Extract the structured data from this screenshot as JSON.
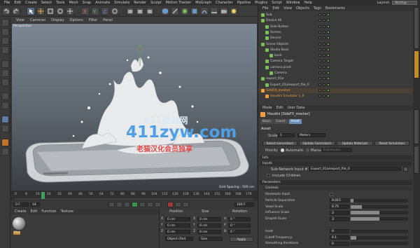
{
  "menubar": {
    "items": [
      "File",
      "Edit",
      "Create",
      "Select",
      "Tools",
      "Mesh",
      "Snap",
      "Animate",
      "Simulate",
      "Render",
      "Sculpt",
      "Motion Tracker",
      "MoGraph",
      "Character",
      "Pipeline",
      "Plugins",
      "Script",
      "Window",
      "Help"
    ],
    "layout_label": "Layout:",
    "layout_value": "Startup"
  },
  "viewport": {
    "menu": [
      "View",
      "Cameras",
      "Display",
      "Options",
      "Filter",
      "Panel"
    ],
    "label": "Perspective",
    "grid_spacing": "Grid Spacing : 500 cm"
  },
  "timeline": {
    "ticks": [
      "0",
      "8",
      "16",
      "24",
      "32",
      "40",
      "48",
      "56",
      "64",
      "72",
      "80",
      "88",
      "96",
      "104",
      "112",
      "120",
      "128",
      "136",
      "144",
      "152",
      "160",
      "168",
      "176"
    ],
    "current": "18 F"
  },
  "transport": {
    "start": "0 F",
    "end": "180 F",
    "frame": "18"
  },
  "material": {
    "menu": [
      "Create",
      "Edit",
      "Function",
      "Texture"
    ],
    "swatch_label": "Mat"
  },
  "coordinates": {
    "headers": [
      "Position",
      "Size",
      "Rotation"
    ],
    "rows": [
      {
        "axis": "X",
        "pos": "0 cm",
        "size_axis": "X",
        "size": "0 cm",
        "rot_axis": "H",
        "rot": "0 °"
      },
      {
        "axis": "Y",
        "pos": "0 cm",
        "size_axis": "Y",
        "size": "0 cm",
        "rot_axis": "P",
        "rot": "0 °"
      },
      {
        "axis": "Z",
        "pos": "0 cm",
        "size_axis": "Z",
        "size": "0 cm",
        "rot_axis": "B",
        "rot": "0 °"
      }
    ],
    "mode": "Object (Rel)",
    "size_mode": "Size",
    "apply": "Apply"
  },
  "objects": {
    "menu": [
      "File",
      "Edit",
      "View",
      "Objects",
      "Tags",
      "Bookmarks"
    ],
    "rows": [
      {
        "name": "Sub",
        "indent": 0,
        "color": "#c8c8c8"
      },
      {
        "name": "Device All",
        "indent": 0,
        "color": "#c8c8c8"
      },
      {
        "name": "Side Button",
        "indent": 1,
        "color": "#c8c8c8"
      },
      {
        "name": "Screen",
        "indent": 1,
        "color": "#c8c8c8"
      },
      {
        "name": "Device",
        "indent": 1,
        "color": "#c8c8c8"
      },
      {
        "name": "Scene Objects",
        "indent": 0,
        "color": "#c8c8c8"
      },
      {
        "name": "Studio Back",
        "indent": 1,
        "color": "#c8c8c8"
      },
      {
        "name": "back",
        "indent": 2,
        "color": "#c8c8c8"
      },
      {
        "name": "Camera Target",
        "indent": 1,
        "color": "#c8c8c8"
      },
      {
        "name": "camera pivot",
        "indent": 1,
        "color": "#c8c8c8"
      },
      {
        "name": "Camera",
        "indent": 2,
        "color": "#c8c8c8"
      },
      {
        "name": "export_01a",
        "indent": 0,
        "color": "#c8c8c8"
      },
      {
        "name": "Export_01a/export_file_0",
        "indent": 1,
        "color": "#c8c8c8"
      },
      {
        "name": "SideFX_mesher",
        "indent": 0,
        "color": "#f0a040"
      },
      {
        "name": "Houdini Emulator 1_0",
        "indent": 1,
        "color": "#f0a040"
      }
    ]
  },
  "attributes": {
    "menu": [
      "Mode",
      "Edit",
      "User Data"
    ],
    "title": "Houdini [SideFX_mesher]",
    "tabs": [
      "Basic",
      "Coord.",
      "Asset"
    ],
    "active_tab": "Asset",
    "asset_section": "Asset",
    "scale_label": "Scale",
    "scale_value": "1",
    "scale_unit": "Meters",
    "buttons": [
      "Select Generators",
      "Update Generators",
      "Update Materials",
      "Reset Simulation"
    ],
    "priority_label": "Priority",
    "priority_value": "Automatic",
    "priority_manual": "Manual",
    "priority_expr": "Expression",
    "info_section": "Info",
    "inputs_section": "Inputs",
    "input_label": "Sub-Network Input #1",
    "input_value": "Export_01a/export_file_0",
    "include_children": "Include Children",
    "params_section": "Parameters",
    "controls_section": "Controls",
    "params": [
      {
        "label": "Resample Input",
        "value": "",
        "fill": 0
      },
      {
        "label": "Particle Separation",
        "value": "0.015",
        "fill": 0.05
      },
      {
        "label": "Voxel Scale",
        "value": "0.75",
        "fill": 0.2
      },
      {
        "label": "Influence Scale",
        "value": "3",
        "fill": 0.5
      },
      {
        "label": "Droplet Scale",
        "value": "3",
        "fill": 0.5
      },
      {
        "label": "",
        "value": "",
        "fill": 0
      },
      {
        "label": "Inset",
        "value": "0",
        "fill": 0
      },
      {
        "label": "Cutoff Frequency",
        "value": "0.1",
        "fill": 0.1
      },
      {
        "label": "Smoothing Iterations",
        "value": "0",
        "fill": 0
      }
    ]
  },
  "watermark": {
    "line1": "411资源网",
    "line2": "411zyw.com",
    "line3": "老猫汉化会员独享"
  }
}
